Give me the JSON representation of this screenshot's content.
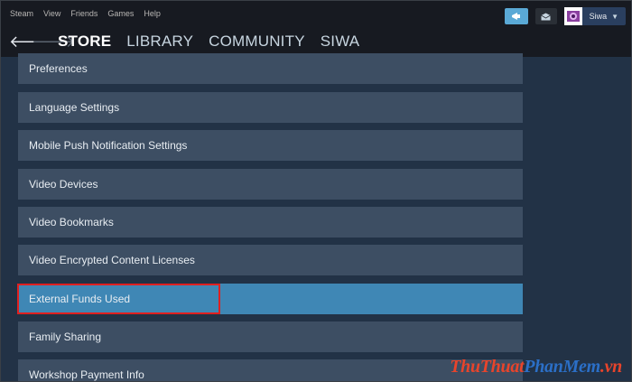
{
  "menu": {
    "items": [
      "Steam",
      "View",
      "Friends",
      "Games",
      "Help"
    ]
  },
  "user": {
    "name": "Siwa"
  },
  "nav": {
    "back_icon": "arrow-left-icon",
    "forward_icon": "arrow-right-icon",
    "links": [
      "STORE",
      "LIBRARY",
      "COMMUNITY",
      "SIWA"
    ],
    "active": "STORE"
  },
  "settings_list": {
    "items": [
      "Preferences",
      "Language Settings",
      "Mobile Push Notification Settings",
      "Video Devices",
      "Video Bookmarks",
      "Video Encrypted Content Licenses",
      "External Funds Used",
      "Family Sharing",
      "Workshop Payment Info"
    ],
    "selected": "External Funds Used"
  },
  "watermark": {
    "part1": "ThuThuat",
    "part2": "PhanMem",
    "part3": ".vn"
  },
  "colors": {
    "background": "#1b2838",
    "list_item": "#3d4e63",
    "selected_item": "#3f87b5",
    "highlight_border": "#e02020",
    "broadcast_button": "#5aa9d6"
  }
}
